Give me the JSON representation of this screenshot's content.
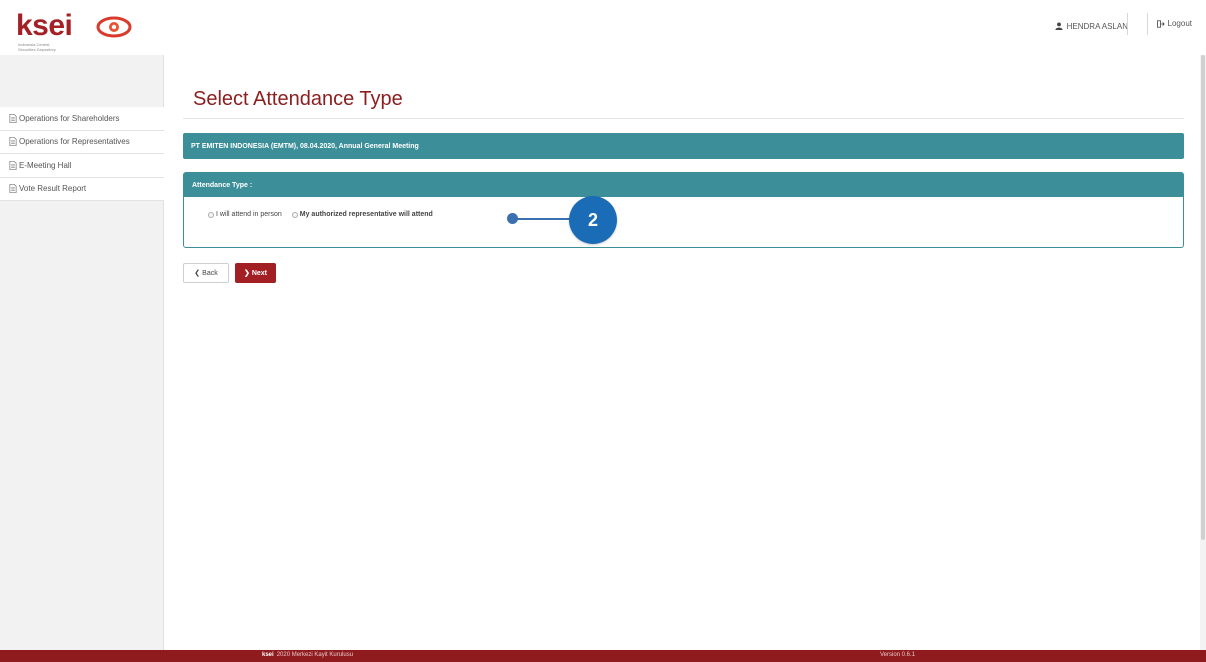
{
  "header": {
    "logo_text": "ksei",
    "logo_sub": "Indonesia Central Securities Depository",
    "user_name": "HENDRA ASLAN",
    "logout_label": "Logout"
  },
  "sidebar": {
    "items": [
      {
        "label": "Operations for Shareholders",
        "icon": "document-icon"
      },
      {
        "label": "Operations for Representatives",
        "icon": "document-icon"
      },
      {
        "label": "E-Meeting Hall",
        "icon": "document-icon"
      },
      {
        "label": "Vote Result Report",
        "icon": "document-icon"
      }
    ]
  },
  "main": {
    "title": "Select Attendance Type",
    "meeting_info": "PT EMITEN INDONESIA (EMTM), 08.04.2020, Annual General Meeting",
    "attendance_panel": {
      "heading": "Attendance Type :",
      "options": [
        {
          "label": "I will attend in person",
          "selected": false
        },
        {
          "label": "My authorized representative will attend",
          "selected": false
        }
      ]
    },
    "buttons": {
      "back_label": "Back",
      "next_label": "Next"
    }
  },
  "callout": {
    "number": "2"
  },
  "footer": {
    "mini_logo": "ksei",
    "copyright": "2020 Merkezi Kayit Kurulusu",
    "version": "Version 0.6.1"
  },
  "colors": {
    "brand_red": "#a21f24",
    "teal": "#3c8f98",
    "callout_blue": "#1b6cb7",
    "footer_red": "#8f1b1e"
  }
}
